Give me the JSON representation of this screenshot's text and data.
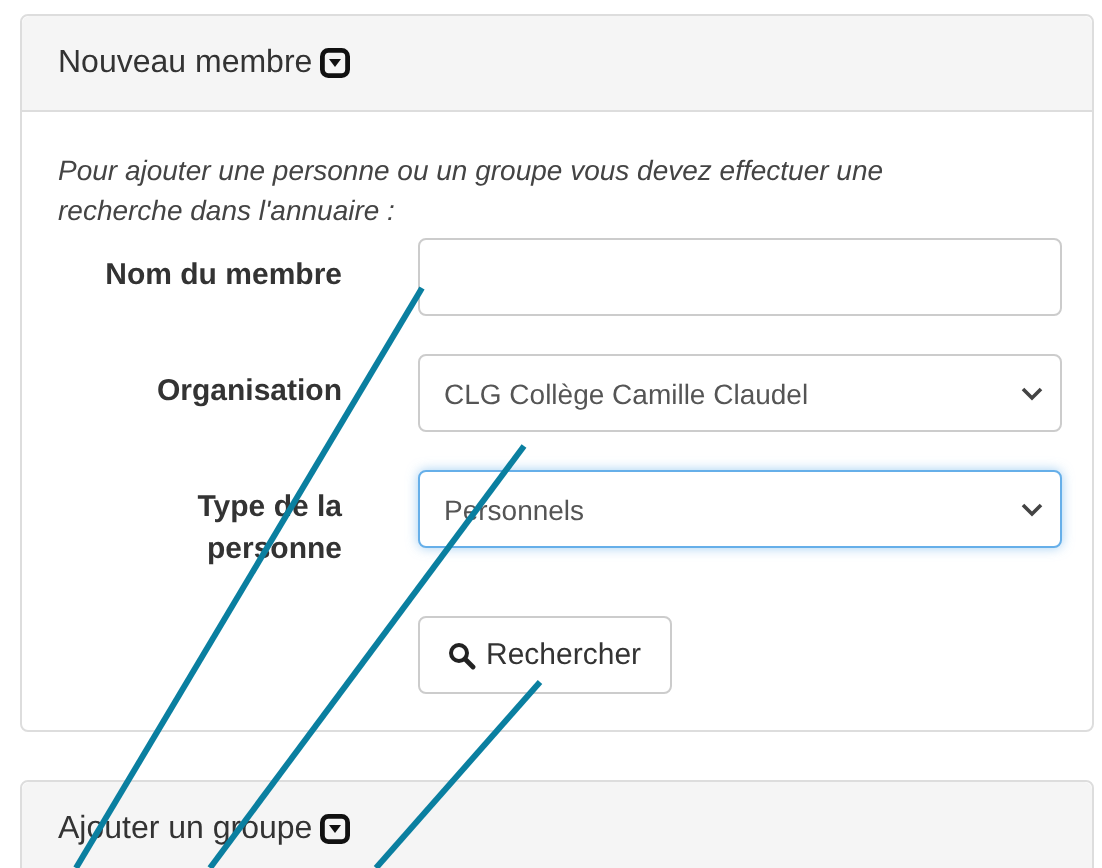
{
  "panels": [
    {
      "title": "Nouveau membre",
      "intro": "Pour ajouter une personne ou un groupe vous devez effectuer une recherche dans l'annuaire :",
      "fields": [
        {
          "label": "Nom du membre",
          "kind": "text",
          "focused": false
        },
        {
          "label": "Organisation",
          "kind": "select",
          "value": "CLG Collège Camille Claudel",
          "focused": false
        },
        {
          "label": "Type de la personne",
          "kind": "select",
          "value": "Personnels",
          "focused": true
        }
      ],
      "button": "Rechercher"
    },
    {
      "title": "Ajouter un groupe"
    }
  ]
}
